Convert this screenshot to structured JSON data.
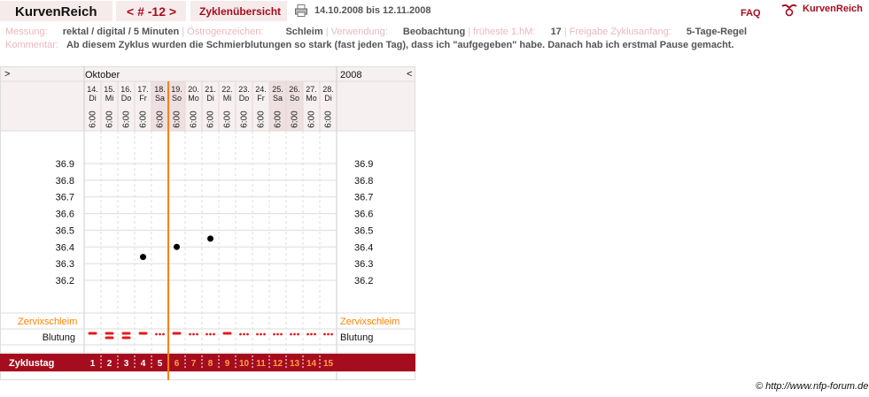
{
  "header": {
    "brand": "KurvenReich",
    "cycle_nav": "< # -12 >",
    "overview_label": "Zyklenübersicht",
    "date_range": "14.10.2008 bis 12.11.2008",
    "faq": "FAQ",
    "logo_text": "KurvenReich",
    "icons": {
      "print": "printer-icon",
      "logo": "kurvenreich-logo-icon"
    }
  },
  "info": {
    "messung_label": "Messung:",
    "messung_value": "rektal / digital / 5 Minuten",
    "oestrogen_label": "Östrogenzeichen:",
    "oestrogen_value": "Schleim",
    "verwendung_label": "Verwendung:",
    "verwendung_value": "Beobachtung",
    "fruehste_label": "früheste 1.hM:",
    "fruehste_value": "17",
    "freigabe_label": "Freigabe Zyklusanfang:",
    "freigabe_value": "5-Tage-Regel",
    "kommentar_label": "Kommentar:",
    "kommentar_value": "Ab diesem Zyklus wurden die Schmierblutungen so stark (fast jeden Tag), dass ich \"aufgegeben\" habe. Danach hab ich erstmal Pause gemacht."
  },
  "chart_data": {
    "type": "scatter",
    "nav_left": ">",
    "nav_right": "<",
    "month_label": "Oktober",
    "year_label": "2008",
    "days": [
      {
        "date": "14.",
        "dow": "Di",
        "time": "6:00",
        "weekend": false
      },
      {
        "date": "15.",
        "dow": "Mi",
        "time": "6:00",
        "weekend": false
      },
      {
        "date": "16.",
        "dow": "Do",
        "time": "6:00",
        "weekend": false
      },
      {
        "date": "17.",
        "dow": "Fr",
        "time": "6:00",
        "weekend": false
      },
      {
        "date": "18.",
        "dow": "Sa",
        "time": "6:00",
        "weekend": true
      },
      {
        "date": "19.",
        "dow": "So",
        "time": "6:00",
        "weekend": true
      },
      {
        "date": "20.",
        "dow": "Mo",
        "time": "6:00",
        "weekend": false
      },
      {
        "date": "21.",
        "dow": "Di",
        "time": "6:00",
        "weekend": false
      },
      {
        "date": "22.",
        "dow": "Mi",
        "time": "6:00",
        "weekend": false
      },
      {
        "date": "23.",
        "dow": "Do",
        "time": "6:00",
        "weekend": false
      },
      {
        "date": "24.",
        "dow": "Fr",
        "time": "6:00",
        "weekend": false
      },
      {
        "date": "25.",
        "dow": "Sa",
        "time": "6:00",
        "weekend": true
      },
      {
        "date": "26.",
        "dow": "So",
        "time": "6:00",
        "weekend": true
      },
      {
        "date": "27.",
        "dow": "Mo",
        "time": "6:00",
        "weekend": false
      },
      {
        "date": "28.",
        "dow": "Di",
        "time": "6:00",
        "weekend": false
      }
    ],
    "y_ticks": [
      "36.9",
      "36.8",
      "36.7",
      "36.6",
      "36.5",
      "36.4",
      "36.3",
      "36.2"
    ],
    "ylim": [
      36.2,
      36.9
    ],
    "temperature_points": [
      {
        "day": 4,
        "value": 36.34
      },
      {
        "day": 6,
        "value": 36.4
      },
      {
        "day": 8,
        "value": 36.45
      }
    ],
    "marker_line_after_day": 5,
    "zervix_label": "Zervixschleim",
    "bleeding_label": "Blutung",
    "bleeding": [
      "medium",
      "heavy",
      "heavy",
      "medium",
      "spotting",
      "medium",
      "spotting",
      "spotting",
      "medium",
      "spotting",
      "spotting",
      "spotting",
      "spotting",
      "spotting",
      "spotting"
    ],
    "cycleday_label": "Zyklustag",
    "cycle_days": [
      "1",
      "2",
      "3",
      "4",
      "5",
      "6",
      "7",
      "8",
      "9",
      "10",
      "11",
      "12",
      "13",
      "14",
      "15"
    ],
    "colors": {
      "accent": "#a50d1e",
      "orange": "#ff7f00",
      "grid": "#dddddd",
      "bleed": "#e31b1b",
      "header_bg": "#f7f0f0"
    }
  },
  "footer": {
    "copyright": "© http://www.nfp-forum.de"
  }
}
